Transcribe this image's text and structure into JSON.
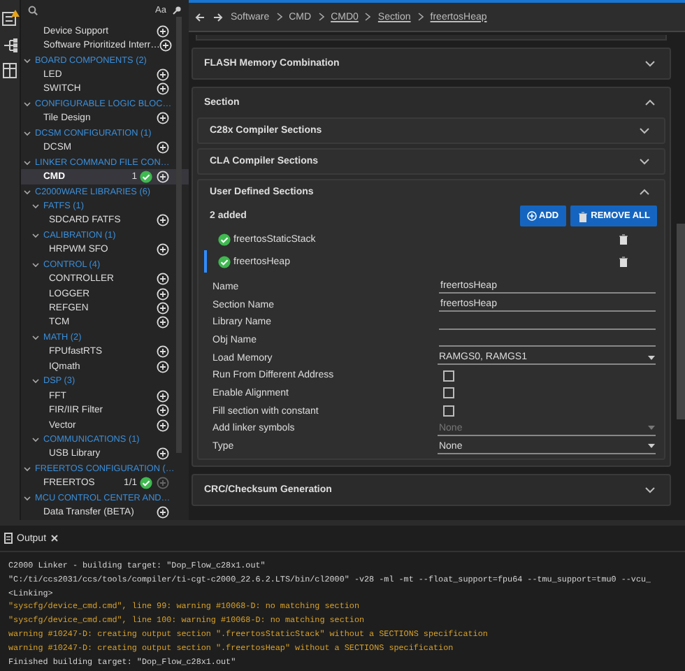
{
  "sidebar": {
    "case_toggle": "Aa",
    "items": [
      {
        "kind": "module",
        "label": "Device Support",
        "selected": false,
        "add_disabled": false
      },
      {
        "kind": "module",
        "label": "Software Prioritized Interr…",
        "selected": false,
        "add_disabled": false
      },
      {
        "kind": "group",
        "label": "BOARD COMPONENTS (2)",
        "expanded": true,
        "children": [
          {
            "kind": "module",
            "label": "LED",
            "selected": false,
            "add_disabled": false
          },
          {
            "kind": "module",
            "label": "SWITCH",
            "selected": false,
            "add_disabled": false
          }
        ]
      },
      {
        "kind": "group",
        "label": "CONFIGURABLE LOGIC BLOC…",
        "expanded": true,
        "children": [
          {
            "kind": "module",
            "label": "Tile Design",
            "selected": false,
            "add_disabled": false
          }
        ]
      },
      {
        "kind": "group",
        "label": "DCSM CONFIGURATION (1)",
        "expanded": true,
        "children": [
          {
            "kind": "module",
            "label": "DCSM",
            "selected": false,
            "add_disabled": false
          }
        ]
      },
      {
        "kind": "group",
        "label": "LINKER COMMAND FILE CON…",
        "expanded": true,
        "children": [
          {
            "kind": "module",
            "label": "CMD",
            "selected": true,
            "count": "1",
            "ok": true,
            "add_disabled": false
          }
        ]
      },
      {
        "kind": "group",
        "label": "C2000WARE LIBRARIES (6)",
        "expanded": true,
        "children": [
          {
            "kind": "group",
            "label": "FATFS (1)",
            "expanded": true,
            "children": [
              {
                "kind": "module",
                "label": "SDCARD FATFS",
                "selected": false,
                "add_disabled": false
              }
            ]
          },
          {
            "kind": "group",
            "label": "CALIBRATION (1)",
            "expanded": true,
            "children": [
              {
                "kind": "module",
                "label": "HRPWM SFO",
                "selected": false,
                "add_disabled": false
              }
            ]
          },
          {
            "kind": "group",
            "label": "CONTROL (4)",
            "expanded": true,
            "children": [
              {
                "kind": "module",
                "label": "CONTROLLER",
                "selected": false,
                "add_disabled": false
              },
              {
                "kind": "module",
                "label": "LOGGER",
                "selected": false,
                "add_disabled": false
              },
              {
                "kind": "module",
                "label": "REFGEN",
                "selected": false,
                "add_disabled": false
              },
              {
                "kind": "module",
                "label": "TCM",
                "selected": false,
                "add_disabled": false
              }
            ]
          },
          {
            "kind": "group",
            "label": "MATH (2)",
            "expanded": true,
            "children": [
              {
                "kind": "module",
                "label": "FPUfastRTS",
                "selected": false,
                "add_disabled": false
              },
              {
                "kind": "module",
                "label": "IQmath",
                "selected": false,
                "add_disabled": false
              }
            ]
          },
          {
            "kind": "group",
            "label": "DSP (3)",
            "expanded": true,
            "children": [
              {
                "kind": "module",
                "label": "FFT",
                "selected": false,
                "add_disabled": false
              },
              {
                "kind": "module",
                "label": "FIR/IIR Filter",
                "selected": false,
                "add_disabled": false
              },
              {
                "kind": "module",
                "label": "Vector",
                "selected": false,
                "add_disabled": false
              }
            ]
          },
          {
            "kind": "group",
            "label": "COMMUNICATIONS (1)",
            "expanded": true,
            "children": [
              {
                "kind": "module",
                "label": "USB Library",
                "selected": false,
                "add_disabled": false
              }
            ]
          }
        ]
      },
      {
        "kind": "group",
        "label": "FREERTOS CONFIGURATION (…",
        "expanded": true,
        "children": [
          {
            "kind": "module",
            "label": "FREERTOS",
            "selected": false,
            "count": "1/1",
            "ok": true,
            "add_disabled": true
          }
        ]
      },
      {
        "kind": "group",
        "label": "MCU CONTROL CENTER AND…",
        "expanded": true,
        "children": [
          {
            "kind": "module",
            "label": "Data Transfer (BETA)",
            "selected": false,
            "add_disabled": false
          }
        ]
      }
    ]
  },
  "breadcrumb": [
    {
      "label": "Software",
      "link": false
    },
    {
      "label": "CMD",
      "link": false
    },
    {
      "label": "CMD0",
      "link": true
    },
    {
      "label": "Section",
      "link": true
    },
    {
      "label": "freertosHeap",
      "link": true
    }
  ],
  "cards": [
    {
      "title": "FLASH Memory Combination",
      "expanded": false
    },
    {
      "title": "Section",
      "expanded": true,
      "children": [
        {
          "title": "C28x Compiler Sections",
          "expanded": false
        },
        {
          "title": "CLA Compiler Sections",
          "expanded": false
        },
        {
          "title": "User Defined Sections",
          "expanded": true,
          "count": "2 added",
          "add_button": "ADD",
          "remove_button": "REMOVE ALL",
          "entries": [
            {
              "label": "freertosStaticStack",
              "selected": false
            },
            {
              "label": "freertosHeap",
              "selected": true
            }
          ],
          "fields": [
            {
              "kind": "text",
              "label": "Name",
              "value": "freertosHeap"
            },
            {
              "kind": "text",
              "label": "Section Name",
              "value": "freertosHeap"
            },
            {
              "kind": "text",
              "label": "Library Name"
            },
            {
              "kind": "text",
              "label": "Obj Name"
            },
            {
              "kind": "select",
              "label": "Load Memory",
              "value": "RAMGS0, RAMGS1",
              "disabled": false
            },
            {
              "kind": "checkbox",
              "label": "Run From Different Address",
              "checked": false
            },
            {
              "kind": "checkbox",
              "label": "Enable Alignment",
              "checked": false
            },
            {
              "kind": "checkbox",
              "label": "Fill section with constant",
              "checked": false
            },
            {
              "kind": "select",
              "label": "Add linker symbols",
              "value": "None",
              "disabled": true
            },
            {
              "kind": "select",
              "label": "Type",
              "value": "None",
              "disabled": false
            }
          ]
        }
      ]
    },
    {
      "title": "CRC/Checksum Generation",
      "expanded": false
    }
  ],
  "output": {
    "title": "Output",
    "lines": [
      {
        "kind": "info",
        "text": "C2000 Linker - building target: \"Dop_Flow_c28x1.out\""
      },
      {
        "kind": "info",
        "text": "\"C:/ti/ccs2031/ccs/tools/compiler/ti-cgt-c2000_22.6.2.LTS/bin/cl2000\" -v28 -ml -mt --float_support=fpu64 --tmu_support=tmu0 --vcu_"
      },
      {
        "kind": "info",
        "text": "<Linking>"
      },
      {
        "kind": "warning",
        "text": "\"syscfg/device_cmd.cmd\", line 99: warning #10068-D: no matching section"
      },
      {
        "kind": "warning",
        "text": "\"syscfg/device_cmd.cmd\", line 100: warning #10068-D: no matching section"
      },
      {
        "kind": "warning",
        "text": "warning #10247-D: creating output section \".freertosStaticStack\" without a SECTIONS specification"
      },
      {
        "kind": "warning",
        "text": "warning #10247-D: creating output section \".freertosHeap\" without a SECTIONS specification"
      },
      {
        "kind": "info",
        "text": "Finished building target: \"Dop_Flow_c28x1.out\""
      }
    ]
  }
}
